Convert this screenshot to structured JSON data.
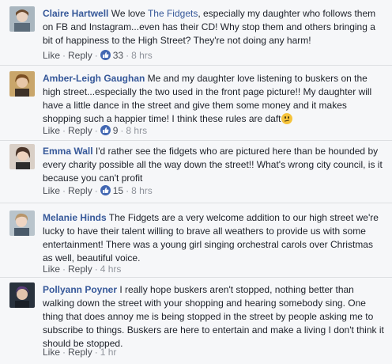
{
  "comments": [
    {
      "author": "Claire Hartwell",
      "text_before": " We love ",
      "link": "The Fidgets",
      "text_after": ", especially my daughter who follows them on FB and Instagram...even has their CD! Why stop them and others bringing a bit of happiness to the High Street? They're not doing any harm!",
      "like_label": "Like",
      "reply_label": "Reply",
      "likes": "33",
      "time": "8 hrs",
      "avatar_color": "#7a8f9e"
    },
    {
      "author": "Amber-Leigh Gaughan",
      "text": " Me and my daughter love listening to buskers on the high street...especially the two used in the front page picture!! My daughter will have a little dance in the street and give them some money and it makes shopping such a happier time! I think these rules are daft",
      "emoji": "confused-face",
      "like_label": "Like",
      "reply_label": "Reply",
      "likes": "9",
      "time": "8 hrs",
      "avatar_color": "#b58a4a"
    },
    {
      "author": "Emma Wall",
      "text": " I'd rather see the fidgets who are pictured here than be hounded by every charity possible all the way down the street!! What's wrong city council, is it because you can't profit",
      "like_label": "Like",
      "reply_label": "Reply",
      "likes": "15",
      "time": "8 hrs",
      "avatar_color": "#6e5a4c"
    },
    {
      "author": "Melanie Hinds",
      "text": " The Fidgets are a very welcome addition to our high street we're lucky to have their talent willing to brave all weathers to provide us with some entertainment! There was a young girl singing orchestral carols over Christmas as well, beautiful voice.",
      "like_label": "Like",
      "reply_label": "Reply",
      "time": "4 hrs",
      "avatar_color": "#8a9aa6"
    },
    {
      "author": "Pollyann Poyner",
      "text": " I really hope buskers aren't stopped, nothing better than walking down the street with your shopping and hearing somebody sing. One thing that does annoy me is being stopped in the street by people asking me to subscribe to things. Buskers are here to entertain and make a living I don't think it should be stopped.",
      "like_label": "Like",
      "reply_label": "Reply",
      "time": "1 hr",
      "avatar_color": "#3e4a5a"
    }
  ]
}
